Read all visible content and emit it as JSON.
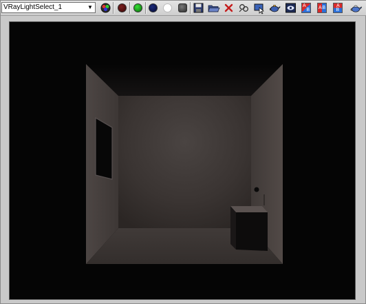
{
  "toolbar": {
    "channel_select": {
      "value": "VRayLightSelect_1"
    },
    "icons": [
      "color-channels-icon",
      "red-channel-icon",
      "green-channel-icon",
      "blue-channel-icon",
      "white-mono-icon",
      "alpha-channel-icon",
      "save-image-icon",
      "open-image-icon",
      "clear-image-icon",
      "link-to-vfb-icon",
      "region-render-icon",
      "render-last-icon",
      "track-mouse-icon",
      "history-a-icon",
      "history-ab-icon",
      "history-b-icon",
      "teapot-render-icon"
    ]
  },
  "colors": {
    "window_bg": "#c9c9c9",
    "render_bg": "#050505",
    "wall_back": "#3a3432",
    "wall_side": "#4a4341",
    "floor": "#3d3735",
    "ceiling": "#0d0c0c"
  }
}
